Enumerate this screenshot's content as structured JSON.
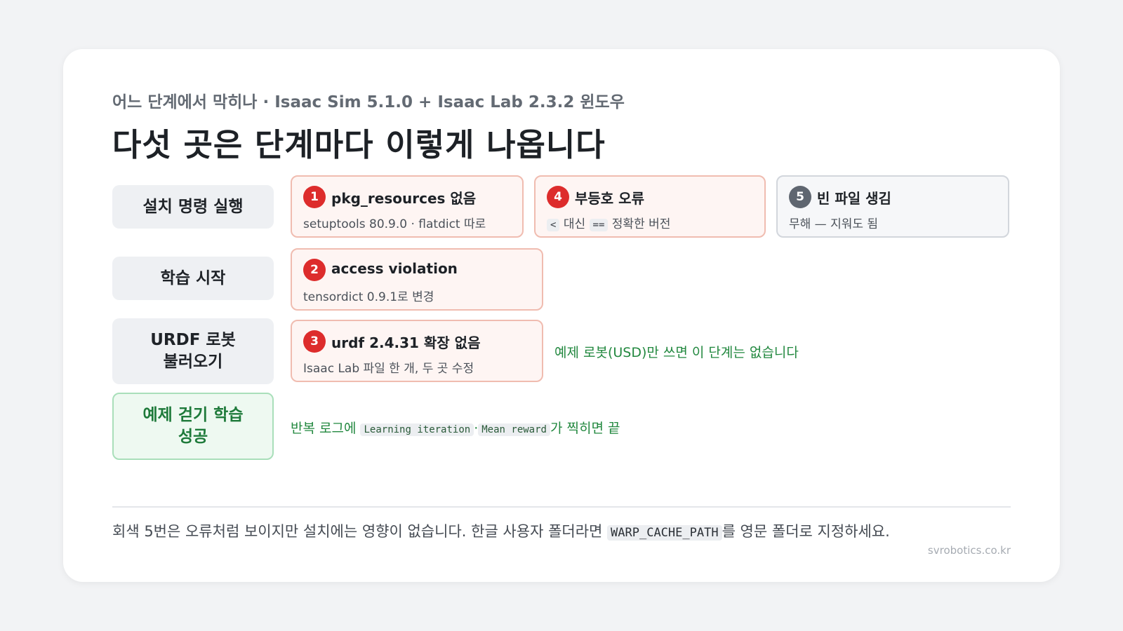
{
  "subtitle": "어느 단계에서 막히나 · Isaac Sim 5.1.0 + Isaac Lab 2.3.2 윈도우",
  "title": "다섯 곳은 단계마다 이렇게 나옵니다",
  "stages": [
    {
      "label": "설치 명령 실행"
    },
    {
      "label": "학습 시작"
    },
    {
      "label_line1": "URDF 로봇",
      "label_line2": "불러오기"
    },
    {
      "label_line1": "예제 걷기 학습",
      "label_line2": "성공"
    }
  ],
  "errors": [
    {
      "num": "1",
      "title": "pkg_resources 없음",
      "desc": "setuptools 80.9.0 · flatdict 따로",
      "color": "#dd2c2c"
    },
    {
      "num": "4",
      "title": "부등호 오류",
      "desc_code1": "<",
      "desc_mid": " 대신 ",
      "desc_code2": "==",
      "desc_end": " 정확한 버전",
      "color": "#dd2c2c"
    },
    {
      "num": "5",
      "title": "빈 파일 생김",
      "desc": "무해 — 지워도 됨",
      "color": "#5f6670"
    },
    {
      "num": "2",
      "title": "access violation",
      "desc": "tensordict 0.9.1로 변경",
      "color": "#dd2c2c"
    },
    {
      "num": "3",
      "title": "urdf 2.4.31 확장 없음",
      "desc": "Isaac Lab 파일 한 개, 두 곳 수정",
      "color": "#dd2c2c"
    }
  ],
  "notes": {
    "urdf_skip": "예제 로봇(USD)만 쓰면 이 단계는 없습니다",
    "success_prefix": "반복 로그에 ",
    "success_code1": "Learning iteration",
    "success_sep": "·",
    "success_code2": "Mean reward",
    "success_suffix": "가 찍히면 끝"
  },
  "footer": {
    "text_before": "회색 5번은 오류처럼 보이지만 설치에는 영향이 없습니다. 한글 사용자 폴더라면 ",
    "code": "WARP_CACHE_PATH",
    "text_after": "를 영문 폴더로 지정하세요."
  },
  "site": "svrobotics.co.kr",
  "colors": {
    "error_red": "#dd2c2c",
    "neutral_gray": "#5f6670",
    "success_green": "#22883f"
  }
}
